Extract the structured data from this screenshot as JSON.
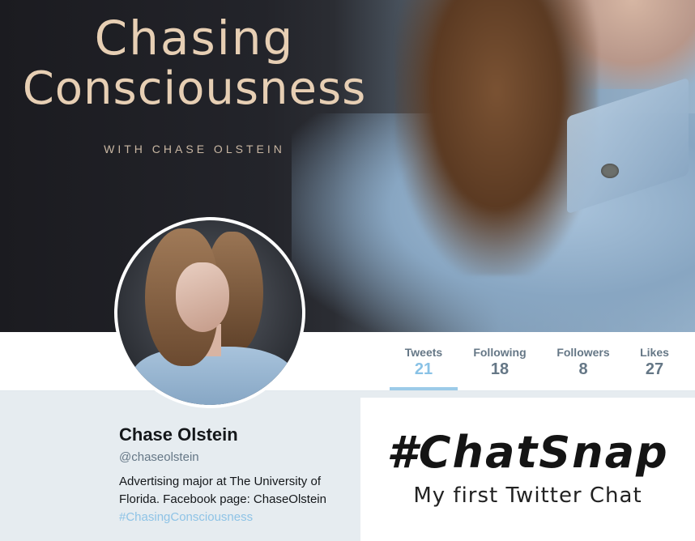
{
  "banner": {
    "title_line1": "Chasing",
    "title_line2": "Consciousness",
    "subtitle": "WITH CHASE OLSTEIN"
  },
  "stats": [
    {
      "label": "Tweets",
      "value": "21",
      "active": true
    },
    {
      "label": "Following",
      "value": "18",
      "active": false
    },
    {
      "label": "Followers",
      "value": "8",
      "active": false
    },
    {
      "label": "Likes",
      "value": "27",
      "active": false
    }
  ],
  "profile": {
    "name": "Chase Olstein",
    "handle": "@chaseolstein",
    "bio_line1": "Advertising major at The University of",
    "bio_line2": "Florida. Facebook page: ChaseOlstein",
    "bio_hashtag": "#ChasingConsciousness"
  },
  "overlay": {
    "title": "#ChatSnap",
    "subtitle": "My first Twitter Chat"
  },
  "colors": {
    "accent": "#89c2e6",
    "background": "#e6ecf0",
    "text": "#14171a",
    "muted": "#657786"
  }
}
